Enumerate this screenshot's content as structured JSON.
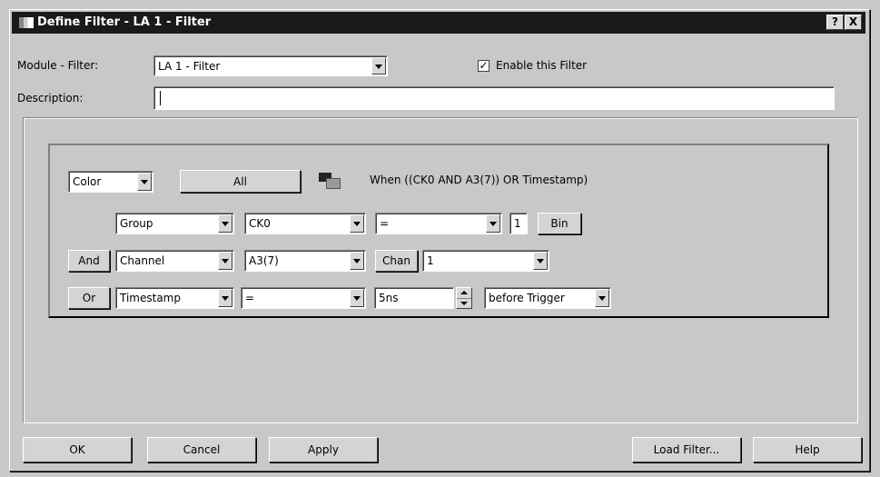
{
  "window": {
    "title": "Define Filter - LA 1 - Filter",
    "help_btn": "?",
    "close_btn": "X"
  },
  "header": {
    "module_label": "Module - Filter:",
    "module_value": "LA 1 - Filter",
    "enable_label": "Enable this Filter",
    "enable_checked": true,
    "description_label": "Description:",
    "description_value": ""
  },
  "filter": {
    "mode_value": "Color",
    "all_label": "All",
    "swatch_icon": "color-swatch-icon",
    "expression": "When ((CK0 AND A3(7)) OR Timestamp)",
    "rows": [
      {
        "connector": "",
        "type": "Group",
        "signal": "CK0",
        "operator": "=",
        "value": "1",
        "radix": "Bin"
      },
      {
        "connector": "And",
        "type": "Channel",
        "signal": "A3(7)",
        "chan_label": "Chan",
        "value": "1"
      },
      {
        "connector": "Or",
        "type": "Timestamp",
        "operator": "=",
        "time": "5ns",
        "relation": "before Trigger"
      }
    ]
  },
  "footer": {
    "ok": "OK",
    "cancel": "Cancel",
    "apply": "Apply",
    "load": "Load Filter...",
    "help": "Help"
  }
}
